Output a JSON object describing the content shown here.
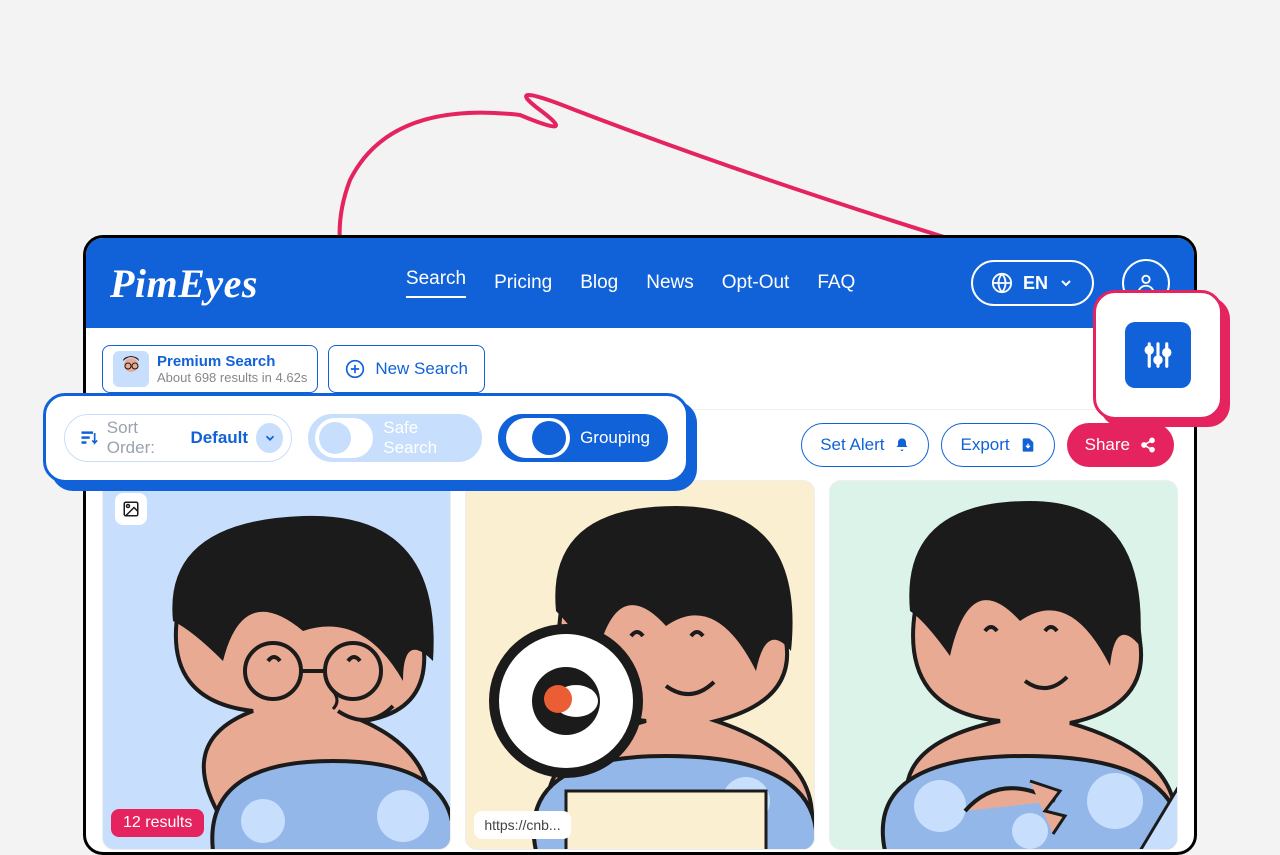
{
  "brand": "PimEyes",
  "nav": {
    "search": "Search",
    "pricing": "Pricing",
    "blog": "Blog",
    "news": "News",
    "optout": "Opt-Out",
    "faq": "FAQ"
  },
  "lang": "EN",
  "premium": {
    "title": "Premium Search",
    "sub": "About 698 results in 4.62s"
  },
  "new_search": "New Search",
  "filters": {
    "sort_label": "Sort Order:",
    "sort_value": "Default",
    "safe_search": "Safe Search",
    "grouping": "Grouping"
  },
  "actions": {
    "set_alert": "Set Alert",
    "export": "Export",
    "share": "Share"
  },
  "results": {
    "count_badge": "12 results",
    "url_preview": "https://cnb..."
  }
}
